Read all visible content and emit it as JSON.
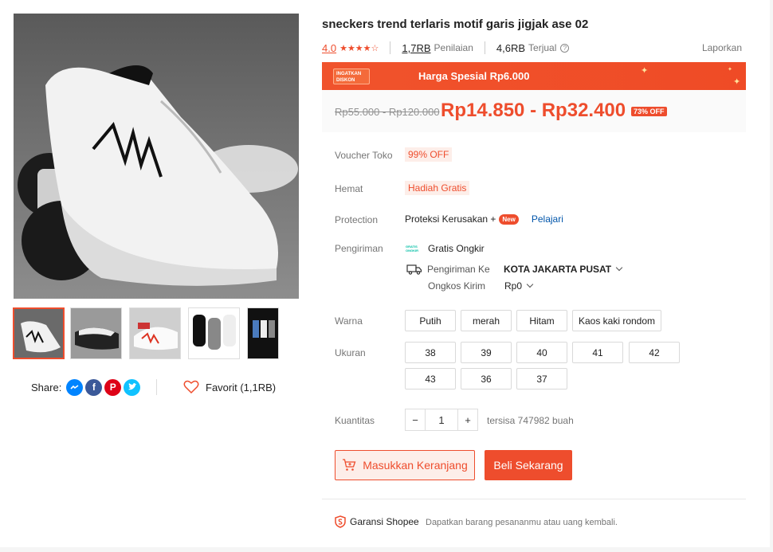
{
  "product": {
    "title": "sneckers trend terlaris motif garis jigjak ase 02",
    "rating": "4.0",
    "stars_filled": 4,
    "stars_total": 5,
    "reviews_count": "1,7RB",
    "reviews_label": "Penilaian",
    "sold_count": "4,6RB",
    "sold_label": "Terjual",
    "report_label": "Laporkan"
  },
  "promo": {
    "badge_text": "INGATKAN DISKON",
    "text": "Harga Spesial Rp6.000"
  },
  "price": {
    "original": "Rp55.000 - Rp120.000",
    "current": "Rp14.850 - Rp32.400",
    "discount_badge": "73% OFF"
  },
  "details": {
    "voucher_label": "Voucher Toko",
    "voucher_value": "99% OFF",
    "hemat_label": "Hemat",
    "hemat_value": "Hadiah Gratis",
    "protection_label": "Protection",
    "protection_value": "Proteksi Kerusakan +",
    "protection_new": "New",
    "protection_link": "Pelajari",
    "shipping_label": "Pengiriman",
    "free_shipping_badge": "GRATIS ONGKIR",
    "free_shipping": "Gratis Ongkir",
    "ship_to_label": "Pengiriman Ke",
    "ship_to_value": "KOTA JAKARTA PUSAT",
    "ship_cost_label": "Ongkos Kirim",
    "ship_cost_value": "Rp0"
  },
  "variants": {
    "color_label": "Warna",
    "colors": [
      "Putih",
      "merah",
      "Hitam",
      "Kaos kaki rondom"
    ],
    "size_label": "Ukuran",
    "sizes": [
      "38",
      "39",
      "40",
      "41",
      "42",
      "43",
      "36",
      "37"
    ]
  },
  "quantity": {
    "label": "Kuantitas",
    "minus": "−",
    "value": "1",
    "plus": "+",
    "stock": "tersisa 747982 buah"
  },
  "actions": {
    "add_to_cart": "Masukkan Keranjang",
    "buy_now": "Beli Sekarang"
  },
  "guarantee": {
    "title": "Garansi Shopee",
    "description": "Dapatkan barang pesananmu atau uang kembali."
  },
  "share": {
    "label": "Share:",
    "favorite_label": "Favorit (1,1RB)"
  },
  "colors": {
    "accent": "#ee4d2d",
    "messenger": "#0084ff",
    "facebook": "#3b5999",
    "pinterest": "#de0217",
    "twitter": "#10c2ff"
  }
}
